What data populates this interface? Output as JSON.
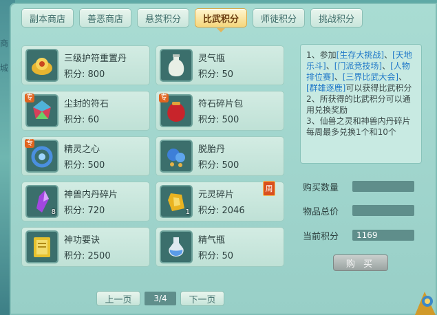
{
  "sidebar": {
    "chars": [
      "商",
      "城"
    ]
  },
  "tabs": [
    {
      "label": "副本商店",
      "active": false
    },
    {
      "label": "善恶商店",
      "active": false
    },
    {
      "label": "悬赏积分",
      "active": false
    },
    {
      "label": "比武积分",
      "active": true
    },
    {
      "label": "师徒积分",
      "active": false
    },
    {
      "label": "挑战积分",
      "active": false
    }
  ],
  "items": [
    {
      "name": "三级护符重置丹",
      "price": "积分: 800",
      "icon": "gold-lotus-pill-icon"
    },
    {
      "name": "灵气瓶",
      "price": "积分: 50",
      "icon": "white-vase-icon"
    },
    {
      "name": "尘封的符石",
      "price": "积分: 60",
      "icon": "rainbow-stone-icon",
      "tag": "专"
    },
    {
      "name": "符石碎片包",
      "price": "积分: 500",
      "icon": "red-pouch-icon",
      "tag": "专"
    },
    {
      "name": "精灵之心",
      "price": "积分: 500",
      "icon": "blue-ring-icon",
      "tag": "专"
    },
    {
      "name": "脱胎丹",
      "price": "积分: 500",
      "icon": "blue-orb-icon"
    },
    {
      "name": "神兽内丹碎片",
      "price": "积分: 720",
      "icon": "purple-crystal-icon",
      "count": "8"
    },
    {
      "name": "元灵碎片",
      "price": "积分: 2046",
      "icon": "gold-fragment-icon",
      "count": "1",
      "badge": "周"
    },
    {
      "name": "神功要诀",
      "price": "积分: 2500",
      "icon": "yellow-book-icon"
    },
    {
      "name": "精气瓶",
      "price": "积分: 50",
      "icon": "potion-bottle-icon"
    }
  ],
  "info": {
    "p1_prefix": "1、参加",
    "link1": "[生存大挑战]",
    "sep1": "、",
    "link2": "[天地乐斗]",
    "sep2": "、",
    "link3": "[门派竞技场]",
    "sep3": "、",
    "link4": "[人物排位赛]",
    "sep4": "、",
    "link5": "[三界比武大会]",
    "sep5": "、",
    "link6": "[群雄逐鹿]",
    "p1_suffix": "可以获得比武积分",
    "p2": "2、所获得的比武积分可以通用兑换奖励",
    "p3": "3、仙兽之灵和神兽内丹碎片每周最多兑换1个和10个"
  },
  "purchase": {
    "qty_label": "购买数量",
    "qty_value": "",
    "total_label": "物品总价",
    "total_value": "",
    "current_label": "当前积分",
    "current_value": "1169",
    "buy_label": "购 买"
  },
  "pager": {
    "prev_label": "上一页",
    "indicator": "3/4",
    "next_label": "下一页"
  },
  "colors": {
    "active_tab": "#f5d67c",
    "link": "#1f78c8",
    "badge": "#d9501f"
  }
}
